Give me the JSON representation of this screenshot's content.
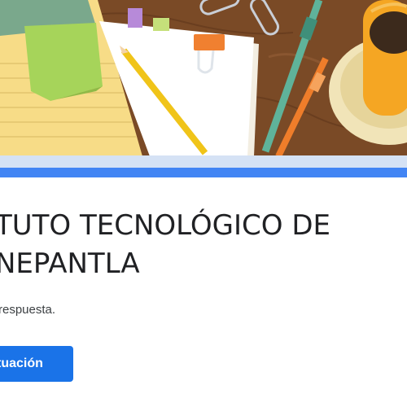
{
  "form": {
    "title_line1": "TUTO TECNOLÓGICO DE",
    "title_line2": "NEPANTLA",
    "description": "respuesta.",
    "button_label": "tuación"
  },
  "colors": {
    "accent": "#4285f4",
    "button": "#1a73e8",
    "banner_desk": "#7a4a26"
  }
}
